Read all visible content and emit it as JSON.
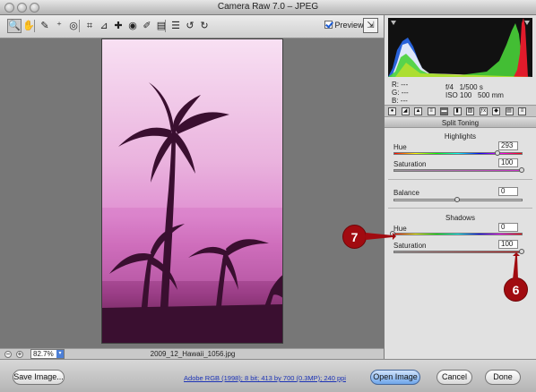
{
  "window": {
    "title": "Camera Raw 7.0  –  JPEG"
  },
  "toolbar": {
    "tools": [
      {
        "icon": "zoom-tool-icon",
        "glyph": "🔍",
        "selected": true
      },
      {
        "icon": "hand-tool-icon",
        "glyph": "✋"
      },
      {
        "icon": "white-balance-tool-icon",
        "glyph": "✎"
      },
      {
        "icon": "color-sampler-tool-icon",
        "glyph": "⁺"
      },
      {
        "icon": "targeted-adjustment-tool-icon",
        "glyph": "◎"
      },
      {
        "icon": "crop-tool-icon",
        "glyph": "⌗"
      },
      {
        "icon": "straighten-tool-icon",
        "glyph": "⊿"
      },
      {
        "icon": "spot-removal-tool-icon",
        "glyph": "✚"
      },
      {
        "icon": "red-eye-removal-tool-icon",
        "glyph": "◉"
      },
      {
        "icon": "adjustment-brush-icon",
        "glyph": "✐"
      },
      {
        "icon": "graduated-filter-icon",
        "glyph": "▤"
      },
      {
        "icon": "open-preferences-icon",
        "glyph": "☰"
      },
      {
        "icon": "rotate-left-icon",
        "glyph": "↺"
      },
      {
        "icon": "rotate-right-icon",
        "glyph": "↻"
      }
    ],
    "preview_label": "Preview",
    "preview_checked": true
  },
  "status": {
    "zoom": "82.7%",
    "filename": "2009_12_Hawaii_1056.jpg"
  },
  "info": {
    "r": "R:",
    "g": "G:",
    "b": "B:",
    "dash": "---",
    "aperture": "f/4",
    "shutter": "1/500 s",
    "iso": "ISO 100",
    "focal": "500 mm"
  },
  "panel": {
    "title": "Split Toning",
    "highlights": {
      "title": "Highlights",
      "hue_label": "Hue",
      "hue": "293",
      "sat_label": "Saturation",
      "sat": "100",
      "hue_pos": 0.814,
      "sat_pos": 1.0
    },
    "balance": {
      "label": "Balance",
      "value": "0",
      "pos": 0.5
    },
    "shadows": {
      "title": "Shadows",
      "hue_label": "Hue",
      "hue": "0",
      "sat_label": "Saturation",
      "sat": "100",
      "hue_pos": 0.0,
      "sat_pos": 1.0
    }
  },
  "bottom": {
    "save": "Save Image...",
    "workflow": "Adobe RGB (1998); 8 bit; 413 by 700 (0.3MP); 240 ppi",
    "open": "Open Image",
    "cancel": "Cancel",
    "done": "Done"
  },
  "callouts": {
    "seven": "7",
    "six": "6"
  },
  "colors": {
    "accent": "#3b7de0",
    "callout": "#a10b10",
    "tint": "#e091d2"
  }
}
